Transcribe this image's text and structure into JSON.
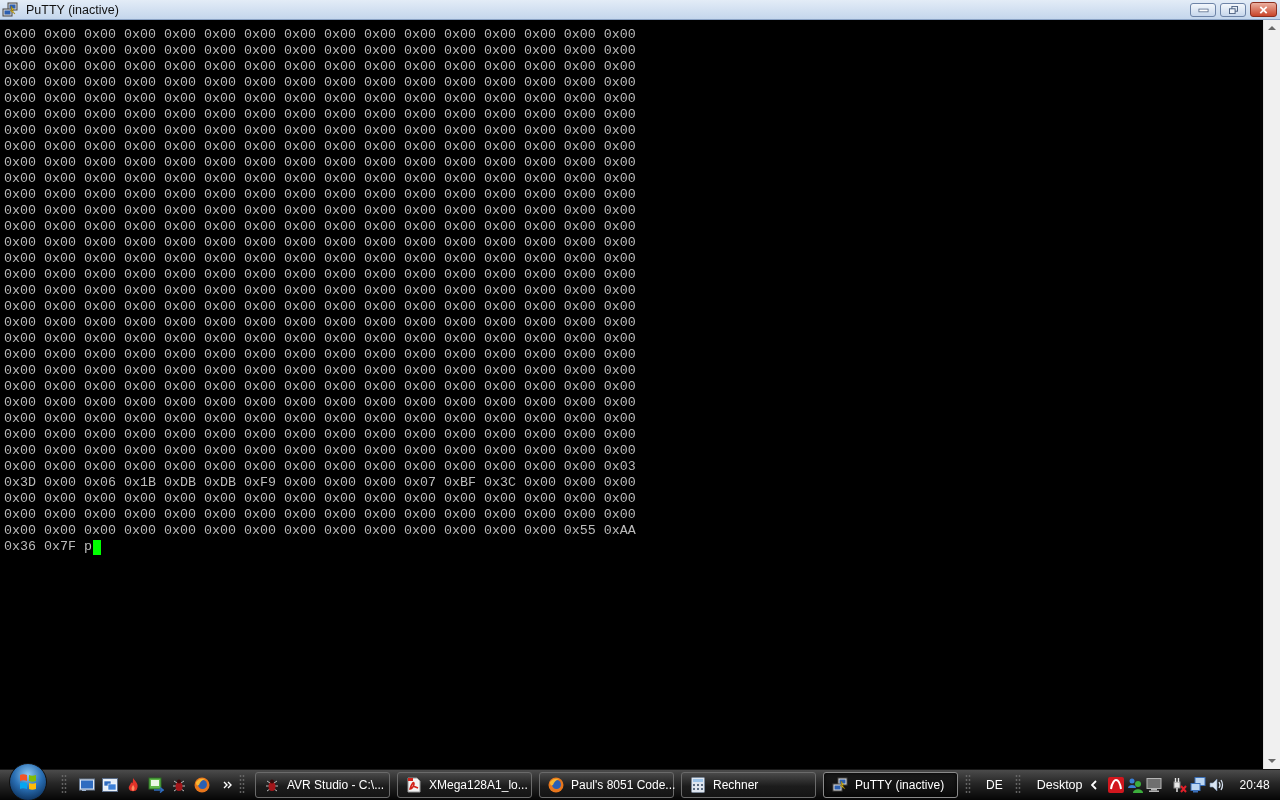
{
  "window": {
    "title": "PuTTY (inactive)"
  },
  "terminal": {
    "lines": [
      "0x00 0x00 0x00 0x00 0x00 0x00 0x00 0x00 0x00 0x00 0x00 0x00 0x00 0x00 0x00 0x00",
      "0x00 0x00 0x00 0x00 0x00 0x00 0x00 0x00 0x00 0x00 0x00 0x00 0x00 0x00 0x00 0x00",
      "0x00 0x00 0x00 0x00 0x00 0x00 0x00 0x00 0x00 0x00 0x00 0x00 0x00 0x00 0x00 0x00",
      "0x00 0x00 0x00 0x00 0x00 0x00 0x00 0x00 0x00 0x00 0x00 0x00 0x00 0x00 0x00 0x00",
      "0x00 0x00 0x00 0x00 0x00 0x00 0x00 0x00 0x00 0x00 0x00 0x00 0x00 0x00 0x00 0x00",
      "0x00 0x00 0x00 0x00 0x00 0x00 0x00 0x00 0x00 0x00 0x00 0x00 0x00 0x00 0x00 0x00",
      "0x00 0x00 0x00 0x00 0x00 0x00 0x00 0x00 0x00 0x00 0x00 0x00 0x00 0x00 0x00 0x00",
      "0x00 0x00 0x00 0x00 0x00 0x00 0x00 0x00 0x00 0x00 0x00 0x00 0x00 0x00 0x00 0x00",
      "0x00 0x00 0x00 0x00 0x00 0x00 0x00 0x00 0x00 0x00 0x00 0x00 0x00 0x00 0x00 0x00",
      "0x00 0x00 0x00 0x00 0x00 0x00 0x00 0x00 0x00 0x00 0x00 0x00 0x00 0x00 0x00 0x00",
      "0x00 0x00 0x00 0x00 0x00 0x00 0x00 0x00 0x00 0x00 0x00 0x00 0x00 0x00 0x00 0x00",
      "0x00 0x00 0x00 0x00 0x00 0x00 0x00 0x00 0x00 0x00 0x00 0x00 0x00 0x00 0x00 0x00",
      "0x00 0x00 0x00 0x00 0x00 0x00 0x00 0x00 0x00 0x00 0x00 0x00 0x00 0x00 0x00 0x00",
      "0x00 0x00 0x00 0x00 0x00 0x00 0x00 0x00 0x00 0x00 0x00 0x00 0x00 0x00 0x00 0x00",
      "0x00 0x00 0x00 0x00 0x00 0x00 0x00 0x00 0x00 0x00 0x00 0x00 0x00 0x00 0x00 0x00",
      "0x00 0x00 0x00 0x00 0x00 0x00 0x00 0x00 0x00 0x00 0x00 0x00 0x00 0x00 0x00 0x00",
      "0x00 0x00 0x00 0x00 0x00 0x00 0x00 0x00 0x00 0x00 0x00 0x00 0x00 0x00 0x00 0x00",
      "0x00 0x00 0x00 0x00 0x00 0x00 0x00 0x00 0x00 0x00 0x00 0x00 0x00 0x00 0x00 0x00",
      "0x00 0x00 0x00 0x00 0x00 0x00 0x00 0x00 0x00 0x00 0x00 0x00 0x00 0x00 0x00 0x00",
      "0x00 0x00 0x00 0x00 0x00 0x00 0x00 0x00 0x00 0x00 0x00 0x00 0x00 0x00 0x00 0x00",
      "0x00 0x00 0x00 0x00 0x00 0x00 0x00 0x00 0x00 0x00 0x00 0x00 0x00 0x00 0x00 0x00",
      "0x00 0x00 0x00 0x00 0x00 0x00 0x00 0x00 0x00 0x00 0x00 0x00 0x00 0x00 0x00 0x00",
      "0x00 0x00 0x00 0x00 0x00 0x00 0x00 0x00 0x00 0x00 0x00 0x00 0x00 0x00 0x00 0x00",
      "0x00 0x00 0x00 0x00 0x00 0x00 0x00 0x00 0x00 0x00 0x00 0x00 0x00 0x00 0x00 0x00",
      "0x00 0x00 0x00 0x00 0x00 0x00 0x00 0x00 0x00 0x00 0x00 0x00 0x00 0x00 0x00 0x00",
      "0x00 0x00 0x00 0x00 0x00 0x00 0x00 0x00 0x00 0x00 0x00 0x00 0x00 0x00 0x00 0x00",
      "0x00 0x00 0x00 0x00 0x00 0x00 0x00 0x00 0x00 0x00 0x00 0x00 0x00 0x00 0x00 0x00",
      "0x00 0x00 0x00 0x00 0x00 0x00 0x00 0x00 0x00 0x00 0x00 0x00 0x00 0x00 0x00 0x03",
      "0x3D 0x00 0x06 0x1B 0xDB 0xDB 0xF9 0x00 0x00 0x00 0x07 0xBF 0x3C 0x00 0x00 0x00",
      "0x00 0x00 0x00 0x00 0x00 0x00 0x00 0x00 0x00 0x00 0x00 0x00 0x00 0x00 0x00 0x00",
      "0x00 0x00 0x00 0x00 0x00 0x00 0x00 0x00 0x00 0x00 0x00 0x00 0x00 0x00 0x00 0x00",
      "0x00 0x00 0x00 0x00 0x00 0x00 0x00 0x00 0x00 0x00 0x00 0x00 0x00 0x00 0x55 0xAA",
      "0x36 0x7F p"
    ],
    "cursor_visible": true
  },
  "taskbar": {
    "tasks": [
      {
        "label": "AVR Studio - C:\\...",
        "kind": "debugger",
        "selected": false
      },
      {
        "label": "XMega128A1_lo...",
        "kind": "pdf",
        "selected": false
      },
      {
        "label": "Paul's 8051 Code...",
        "kind": "browser",
        "selected": false
      },
      {
        "label": "Rechner",
        "kind": "calculator",
        "selected": false
      },
      {
        "label": "PuTTY (inactive)",
        "kind": "terminal",
        "selected": true
      }
    ],
    "language": "DE",
    "desktop_toolbar": "Desktop",
    "clock": "20:48"
  }
}
